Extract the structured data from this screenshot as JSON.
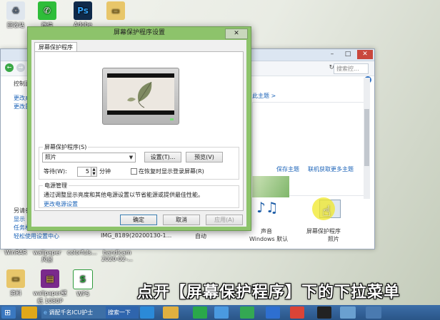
{
  "desktop": {
    "icons_top": [
      {
        "label": "回收站"
      },
      {
        "label": "微信"
      },
      {
        "label": "Adobe"
      },
      {
        "label": ""
      }
    ],
    "icons_bottom": [
      {
        "label": "WinRAR"
      },
      {
        "label": "wallpaper 风景"
      },
      {
        "label": "colorfuls..."
      },
      {
        "label": "bandicam 2020-02-..."
      }
    ],
    "icons_bottom2": [
      {
        "label": "资料"
      },
      {
        "label": "wallpaper壁纸 1080P"
      },
      {
        "label": "WPS"
      }
    ]
  },
  "control_panel": {
    "search_placeholder": "搜索控...",
    "left_links": [
      "控制面",
      "更改桌",
      "更改鼠",
      "另请参",
      "显示",
      "任务栏",
      "轻松使用设置中心"
    ],
    "right_link1": "此主题 >",
    "save_theme": "保存主题",
    "get_more_themes": "联机获取更多主题",
    "thumbnails": [
      {
        "caption": "IMG_8189(20200130-1...",
        "sub": ""
      },
      {
        "caption": "自动",
        "sub": ""
      },
      {
        "caption": "声音",
        "sub": "Windows 默认"
      },
      {
        "caption": "屏幕保护程序",
        "sub": "照片"
      }
    ]
  },
  "dialog": {
    "title": "屏幕保护程序设置",
    "close_label": "✕",
    "tab_label": "屏幕保护程序",
    "screensaver_group_label": "屏幕保护程序(S)",
    "screensaver_selected": "照片",
    "settings_button": "设置(T)...",
    "preview_button": "预览(V)",
    "wait_label": "等待(W):",
    "wait_value": "5",
    "minutes_label": "分钟",
    "resume_checkbox_label": "在恢复时显示登录屏幕(R)",
    "resume_checked": false,
    "power_group_label": "电源管理",
    "power_desc": "通过调整显示亮度和其他电源设置以节省能源或提供最佳性能。",
    "power_link": "更改电源设置",
    "ok_button": "确定",
    "cancel_button": "取消",
    "apply_button": "应用(A)"
  },
  "caption": "点开【屏幕保护程序】下的下拉菜单",
  "taskbar": {
    "task1": "调配千名ICU护士",
    "task2": "搜索一下"
  }
}
